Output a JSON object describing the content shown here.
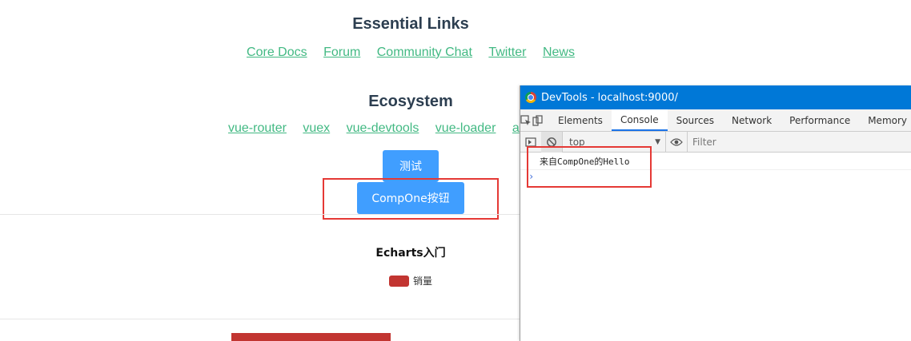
{
  "page": {
    "essential_title": "Essential Links",
    "essential_links": [
      "Core Docs",
      "Forum",
      "Community Chat",
      "Twitter",
      "News"
    ],
    "ecosystem_title": "Ecosystem",
    "ecosystem_links": [
      "vue-router",
      "vuex",
      "vue-devtools",
      "vue-loader",
      "a"
    ],
    "test_button": "测试",
    "comp_button": "CompOne按钮",
    "chart_title": "Echarts入门",
    "legend_label": "销量",
    "accent_color": "#409eff",
    "link_color": "#42b983",
    "series_color": "#c23531"
  },
  "devtools": {
    "title": "DevTools - localhost:9000/",
    "tabs": [
      "Elements",
      "Console",
      "Sources",
      "Network",
      "Performance",
      "Memory"
    ],
    "active_tab": "Console",
    "context": "top",
    "filter_placeholder": "Filter",
    "log_line": "来自CompOne的Hello",
    "prompt": "›",
    "title_bar_color": "#0078d7"
  }
}
